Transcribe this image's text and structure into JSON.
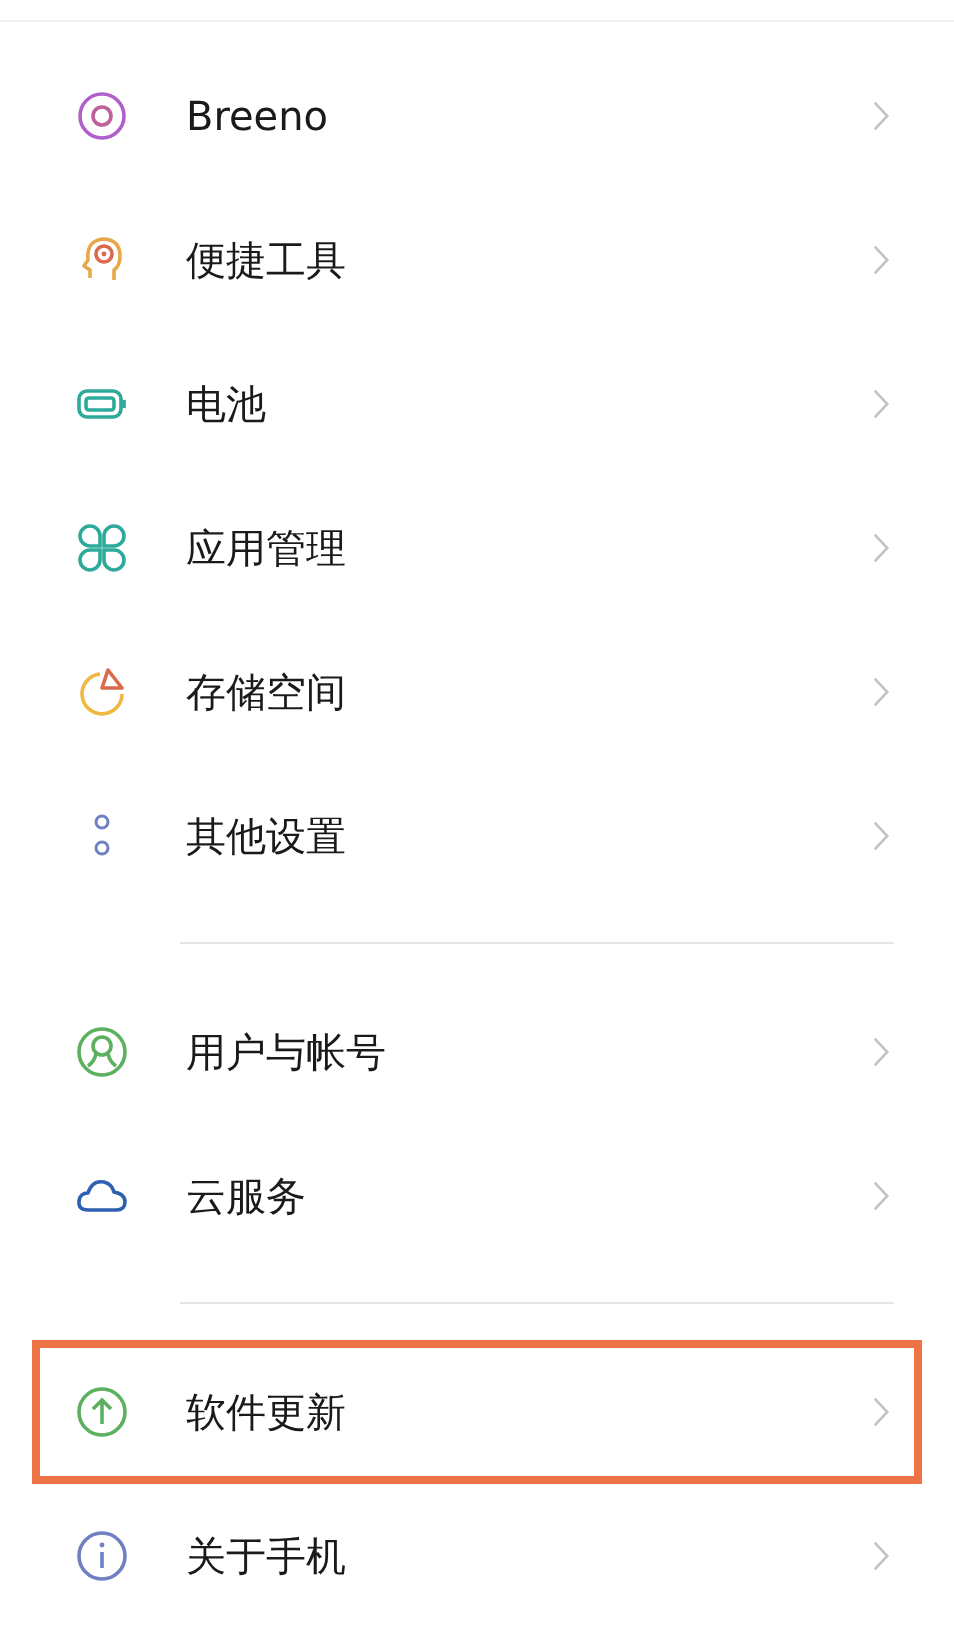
{
  "groups": [
    {
      "items": [
        {
          "kind": "target",
          "label": "Breeno",
          "highlighted": false
        },
        {
          "kind": "head",
          "label": "便捷工具",
          "highlighted": false
        },
        {
          "kind": "battery",
          "label": "电池",
          "highlighted": false
        },
        {
          "kind": "apps",
          "label": "应用管理",
          "highlighted": false
        },
        {
          "kind": "storage",
          "label": "存储空间",
          "highlighted": false
        },
        {
          "kind": "dots",
          "label": "其他设置",
          "highlighted": false
        }
      ]
    },
    {
      "items": [
        {
          "kind": "user",
          "label": "用户与帐号",
          "highlighted": false
        },
        {
          "kind": "cloud",
          "label": "云服务",
          "highlighted": false
        }
      ]
    },
    {
      "items": [
        {
          "kind": "update",
          "label": "软件更新",
          "highlighted": true
        },
        {
          "kind": "info",
          "label": "关于手机",
          "highlighted": false
        }
      ]
    }
  ]
}
